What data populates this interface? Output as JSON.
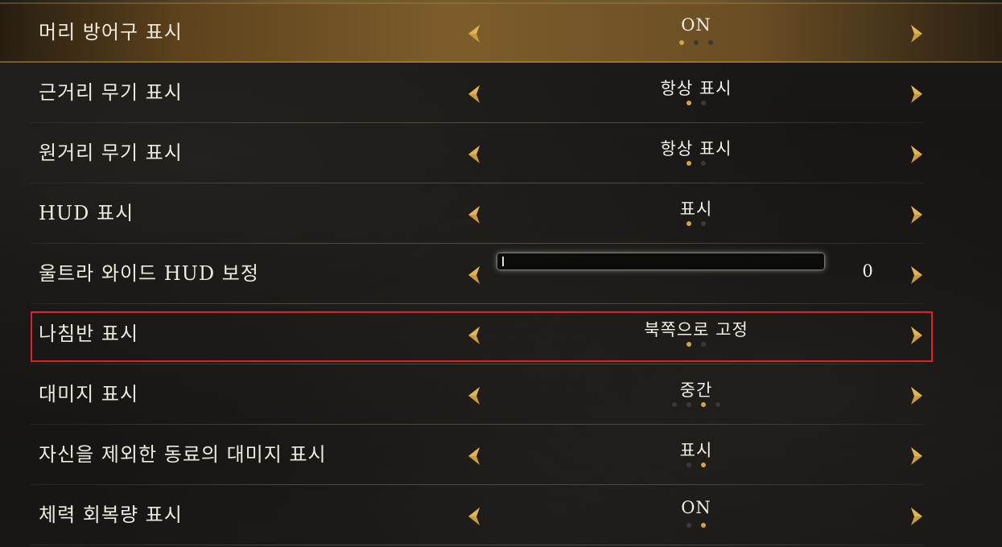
{
  "settings": [
    {
      "label": "머리 방어구 표시",
      "value": "ON",
      "option_count": 3,
      "option_index": 0,
      "selected": true
    },
    {
      "label": "근거리 무기 표시",
      "value": "항상 표시",
      "option_count": 2,
      "option_index": 0
    },
    {
      "label": "원거리 무기 표시",
      "value": "항상 표시",
      "option_count": 2,
      "option_index": 0
    },
    {
      "label": "HUD 표시",
      "value": "표시",
      "option_count": 2,
      "option_index": 0
    },
    {
      "label": "울트라 와이드 HUD 보정",
      "type": "slider",
      "slider_value": "0",
      "slider_fraction": 0
    },
    {
      "label": "나침반 표시",
      "value": "북쪽으로 고정",
      "option_count": 2,
      "option_index": 0,
      "highlighted": true
    },
    {
      "label": "대미지 표시",
      "value": "중간",
      "option_count": 4,
      "option_index": 2
    },
    {
      "label": "자신을 제외한 동료의 대미지 표시",
      "value": "표시",
      "option_count": 2,
      "option_index": 1
    },
    {
      "label": "체력 회복량 표시",
      "value": "ON",
      "option_count": 2,
      "option_index": 1
    }
  ],
  "icons": {
    "left": "chevron-left-icon",
    "right": "chevron-right-icon"
  },
  "colors": {
    "accent_gold": "#d4a446",
    "highlight_red": "#e0202b",
    "selected_row_gold": "#82602c"
  }
}
